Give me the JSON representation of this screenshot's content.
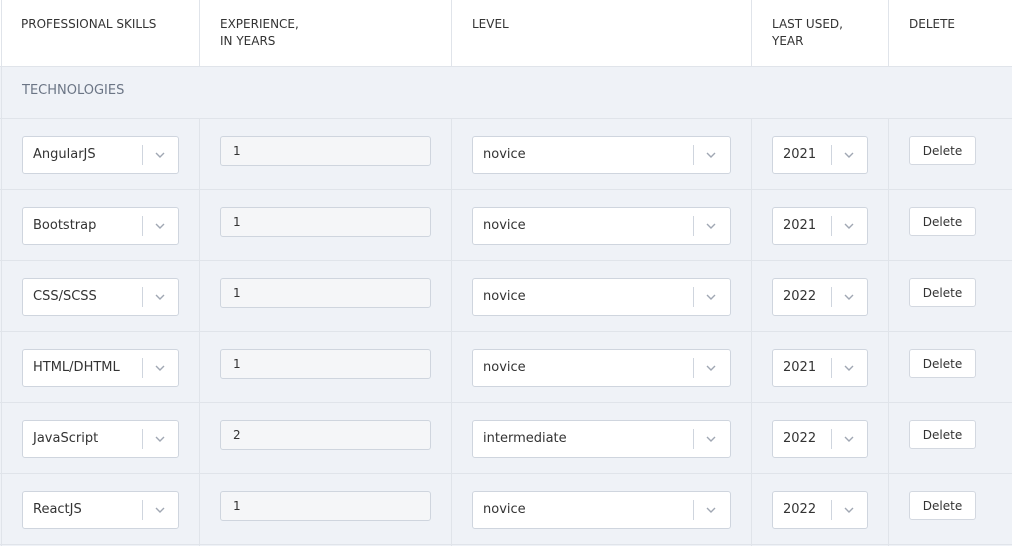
{
  "header": {
    "skills": "PROFESSIONAL SKILLS",
    "experience_line1": "EXPERIENCE,",
    "experience_line2": "IN YEARS",
    "level": "LEVEL",
    "last_used_line1": "LAST USED,",
    "last_used_line2": "YEAR",
    "delete": "DELETE"
  },
  "group": {
    "label": "TECHNOLOGIES"
  },
  "rows": [
    {
      "skill": "AngularJS",
      "experience": "1",
      "level": "novice",
      "year": "2021",
      "delete_label": "Delete"
    },
    {
      "skill": "Bootstrap",
      "experience": "1",
      "level": "novice",
      "year": "2021",
      "delete_label": "Delete"
    },
    {
      "skill": "CSS/SCSS",
      "experience": "1",
      "level": "novice",
      "year": "2022",
      "delete_label": "Delete"
    },
    {
      "skill": "HTML/DHTML",
      "experience": "1",
      "level": "novice",
      "year": "2021",
      "delete_label": "Delete"
    },
    {
      "skill": "JavaScript",
      "experience": "2",
      "level": "intermediate",
      "year": "2022",
      "delete_label": "Delete"
    },
    {
      "skill": "ReactJS",
      "experience": "1",
      "level": "novice",
      "year": "2022",
      "delete_label": "Delete"
    }
  ],
  "colors": {
    "header_bg": "#ffffff",
    "body_bg": "#eff2f7",
    "border": "#e0e4ea",
    "group_label": "#6b7585"
  },
  "icons": {
    "dropdown": "chevron-down-icon"
  }
}
